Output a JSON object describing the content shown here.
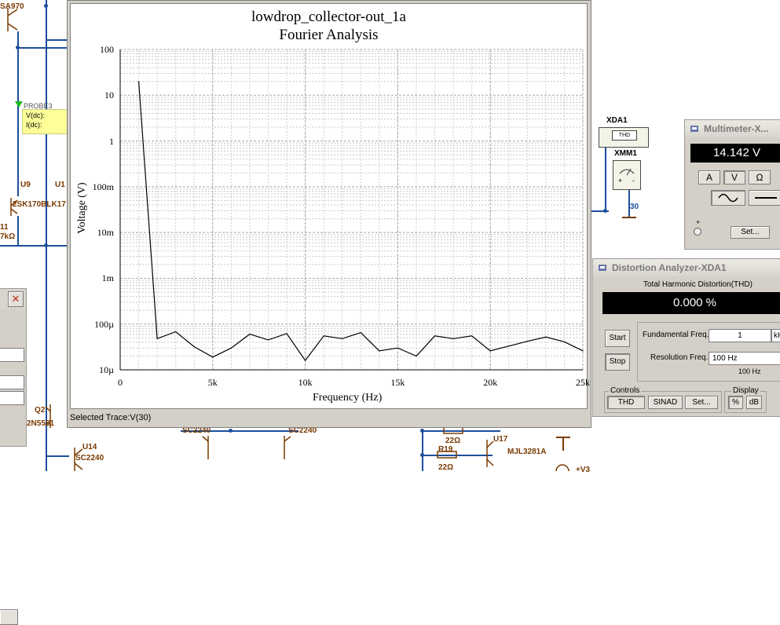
{
  "schematic": {
    "components": [
      {
        "id": "sa970",
        "label": "SA970"
      },
      {
        "id": "u9",
        "label": "U9"
      },
      {
        "id": "u1",
        "label": "U1"
      },
      {
        "id": "2sk170",
        "label": "2SK170BLK17"
      },
      {
        "id": "r11",
        "label": "11"
      },
      {
        "id": "r11val",
        "label": "7kΩ"
      },
      {
        "id": "q2",
        "label": "Q2"
      },
      {
        "id": "2n5551",
        "label": "2N5551"
      },
      {
        "id": "u14",
        "label": "U14"
      },
      {
        "id": "sc2240a",
        "label": "SC2240"
      },
      {
        "id": "sc2240b",
        "label": "SC2240"
      },
      {
        "id": "sc2240c",
        "label": "SC2240"
      },
      {
        "id": "r19val",
        "label": "22Ω"
      },
      {
        "id": "r19",
        "label": "R19"
      },
      {
        "id": "r19val2",
        "label": "22Ω"
      },
      {
        "id": "u17",
        "label": "U17"
      },
      {
        "id": "mjl3281a",
        "label": "MJL3281A"
      },
      {
        "id": "v3",
        "label": "+V3"
      },
      {
        "id": "net30",
        "label": "30"
      }
    ],
    "probe": {
      "name": "PROBE3",
      "v": "V(dc):",
      "i": "I(dc):"
    }
  },
  "graph": {
    "title": "lowdrop_collector-out_1a",
    "subtitle": "Fourier Analysis",
    "status": "Selected Trace:V(30)"
  },
  "chart_data": {
    "type": "line",
    "title": "lowdrop_collector-out_1a",
    "subtitle": "Fourier Analysis",
    "xlabel": "Frequency (Hz)",
    "ylabel": "Voltage (V)",
    "xscale": "linear",
    "yscale": "log",
    "xlim": [
      0,
      25000
    ],
    "ylim": [
      1e-05,
      100
    ],
    "xticks": [
      "0",
      "5k",
      "10k",
      "15k",
      "20k",
      "25k"
    ],
    "yticks": [
      "100",
      "10",
      "1",
      "100m",
      "10m",
      "1m",
      "100µ",
      "10µ"
    ],
    "grid": true,
    "series": [
      {
        "color": "#000000",
        "x": [
          1000,
          2000,
          3000,
          4000,
          5000,
          6000,
          7000,
          8000,
          9000,
          10000,
          11000,
          12000,
          13000,
          14000,
          15000,
          16000,
          17000,
          18000,
          19000,
          20000,
          21000,
          22000,
          23000,
          24000,
          25000
        ],
        "y": [
          20,
          4.8e-05,
          6.8e-05,
          3.2e-05,
          1.9e-05,
          3e-05,
          6e-05,
          4.5e-05,
          6.2e-05,
          1.6e-05,
          5.5e-05,
          4.8e-05,
          6.5e-05,
          2.6e-05,
          3e-05,
          2e-05,
          5.5e-05,
          4.8e-05,
          5.5e-05,
          2.6e-05,
          3.3e-05,
          4.2e-05,
          5.2e-05,
          4.1e-05,
          2.6e-05
        ]
      }
    ]
  },
  "xda1_icon": {
    "label": "XDA1",
    "inner": "THD"
  },
  "xmm1_icon": {
    "label": "XMM1",
    "plus": "+",
    "minus": "-"
  },
  "multimeter": {
    "title": "Multimeter-X...",
    "reading": "14.142 V",
    "modes": [
      "A",
      "V",
      "Ω"
    ],
    "set_label": "Set...",
    "plus": "+"
  },
  "distortion": {
    "title": "Distortion Analyzer-XDA1",
    "thd_label": "Total Harmonic Distortion(THD)",
    "reading": "0.000 %",
    "start": "Start",
    "stop": "Stop",
    "fund_label": "Fundamental Freq.",
    "fund_value": "1",
    "fund_unit": "kH",
    "res_label": "Resolution Freq.",
    "res_value": "100 Hz",
    "res_note": "100 Hz",
    "controls_label": "Controls",
    "thd_btn": "THD",
    "sinad_btn": "SINAD",
    "set_btn": "Set...",
    "display_label": "Display",
    "pct_btn": "%",
    "db_btn": "dB"
  },
  "left_window": {
    "close": "✕"
  }
}
